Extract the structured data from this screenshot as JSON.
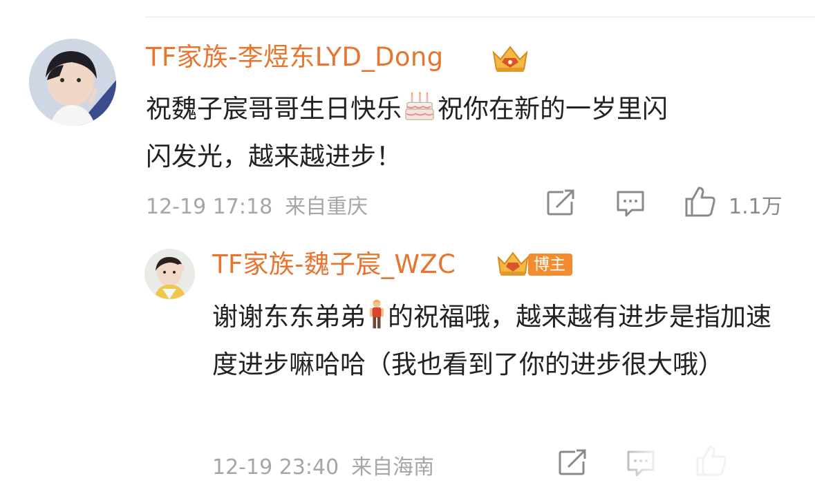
{
  "comment": {
    "author": "TF家族-李煜东LYD_Dong",
    "text_line1": "祝魏子宸哥哥生日快乐",
    "text_line1b": "祝你在新的一岁里闪",
    "text_line2": "闪发光，越来越进步！",
    "emoji": "birthday-cake",
    "time": "12-19 17:18",
    "location": "来自重庆",
    "like_count": "1.1万",
    "avatar": "avatar-user-1"
  },
  "reply": {
    "author": "TF家族-魏子宸_WZC",
    "badge": "博主",
    "text_part1": "谢谢东东弟弟",
    "text_part2": "的祝福哦，越来越有进步是指加速度进步嘛哈哈（我也看到了你的进步很大哦）",
    "emoji": "person-standing",
    "time": "12-19 23:40",
    "location": "来自海南",
    "avatar": "avatar-user-2"
  },
  "icons": [
    "crown-icon",
    "share-icon",
    "comment-icon",
    "like-icon"
  ],
  "colors": {
    "accent": "#e8742e",
    "meta": "#a6a6a6",
    "badge_bg": "#f28c2f"
  }
}
